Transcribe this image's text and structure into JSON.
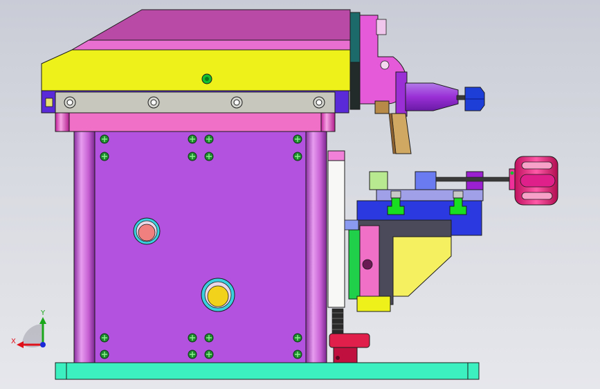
{
  "viewport": {
    "background_top": "#c9ccd6",
    "background_bottom": "#e6e7ec"
  },
  "triad": {
    "x_label": "X",
    "y_label": "Y",
    "x_color": "#e0101a",
    "y_color": "#1aa81a",
    "z_color": "#1a2ad8"
  },
  "colors": {
    "top_head": "#b94aa6",
    "head_band": "#e86fd0",
    "yellow_block": "#eef21a",
    "grey_plate": "#c7c7bd",
    "pink_plate": "#f070c8",
    "column": "#c65fd2",
    "main_panel": "#b352df",
    "base_plate": "#3cf0c0",
    "slide_blue": "#2a3ae0",
    "clamp_pink": "#f0309a",
    "screw_green": "#1f8a2f",
    "knob_yellow": "#f2d21a"
  }
}
